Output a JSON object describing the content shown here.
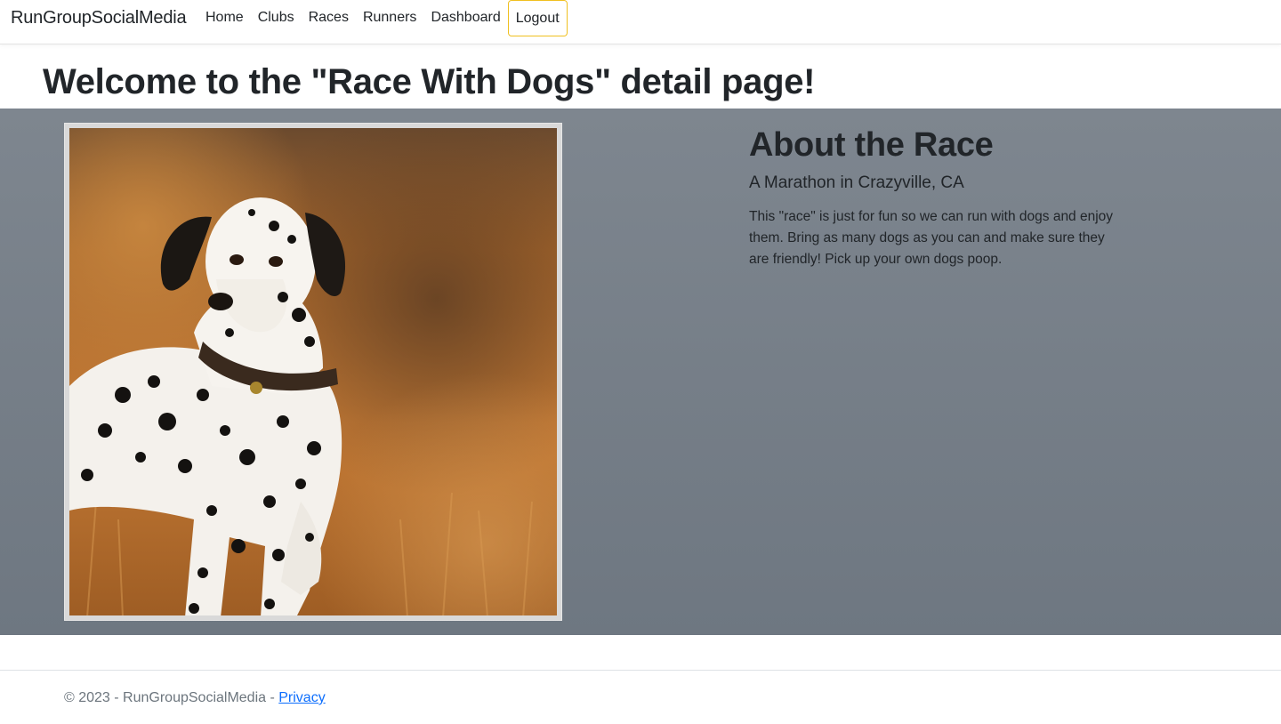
{
  "navbar": {
    "brand": "RunGroupSocialMedia",
    "links": [
      {
        "label": "Home"
      },
      {
        "label": "Clubs"
      },
      {
        "label": "Races"
      },
      {
        "label": "Runners"
      },
      {
        "label": "Dashboard"
      },
      {
        "label": "Logout"
      }
    ]
  },
  "page": {
    "heading": "Welcome to the \"Race With Dogs\" detail page!"
  },
  "race": {
    "image_description": "dalmatian-dog-photo",
    "about_title": "About the Race",
    "subtitle": "A Marathon in Crazyville, CA",
    "description": "This \"race\" is just for fun so we can run with dogs and enjoy them. Bring as many dogs as you can and make sure they are friendly! Pick up your own dogs poop."
  },
  "footer": {
    "text": "© 2023 - RunGroupSocialMedia - ",
    "privacy_link": "Privacy"
  },
  "colors": {
    "band_top": "#7e868f",
    "band_bottom": "#6e7781",
    "logout_border": "#f0c020",
    "link": "#0d6efd"
  }
}
